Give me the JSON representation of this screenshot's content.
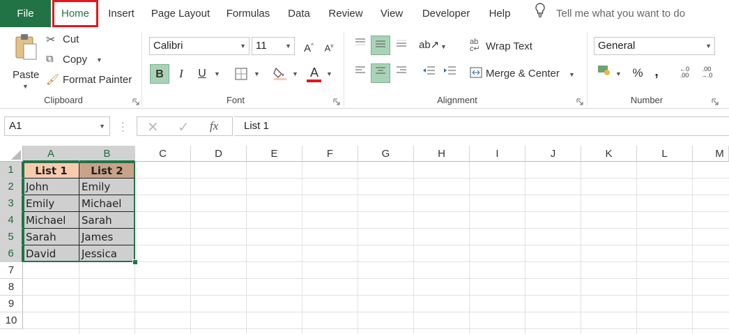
{
  "ribbon_tabs": [
    {
      "label": "File"
    },
    {
      "label": "Home"
    },
    {
      "label": "Insert"
    },
    {
      "label": "Page Layout"
    },
    {
      "label": "Formulas"
    },
    {
      "label": "Data"
    },
    {
      "label": "Review"
    },
    {
      "label": "View"
    },
    {
      "label": "Developer"
    },
    {
      "label": "Help"
    }
  ],
  "tell_me": {
    "placeholder": "Tell me what you want to do"
  },
  "clipboard": {
    "group_label": "Clipboard",
    "paste": "Paste",
    "cut": "Cut",
    "copy": "Copy",
    "format_painter": "Format Painter"
  },
  "font": {
    "group_label": "Font",
    "family": "Calibri",
    "size": "11",
    "bold": "B",
    "italic": "I",
    "underline": "U",
    "font_color": "A"
  },
  "alignment": {
    "group_label": "Alignment",
    "wrap_text": "Wrap Text",
    "merge_center": "Merge & Center"
  },
  "number": {
    "group_label": "Number",
    "format": "General",
    "percent": "%",
    "comma": ","
  },
  "formula_bar": {
    "name_box": "A1",
    "fx": "fx",
    "content": "List 1"
  },
  "sheet": {
    "columns": [
      "A",
      "B",
      "C",
      "D",
      "E",
      "F",
      "G",
      "H",
      "I",
      "J",
      "K",
      "L",
      "M"
    ],
    "rows": [
      "1",
      "2",
      "3",
      "4",
      "5",
      "6",
      "7",
      "8",
      "9",
      "10"
    ],
    "cells": [
      [
        "List 1",
        "List 2"
      ],
      [
        "John",
        "Emily"
      ],
      [
        "Emily",
        "Michael"
      ],
      [
        "Michael",
        "Sarah"
      ],
      [
        "Sarah",
        "James"
      ],
      [
        "David",
        "Jessica"
      ]
    ]
  },
  "colors": {
    "accent": "#217346",
    "highlight_tab_border": "#e8141c",
    "header_a_fill": "#f8cbad",
    "header_b_fill": "#c9a389",
    "data_fill": "#cfcfcf"
  }
}
